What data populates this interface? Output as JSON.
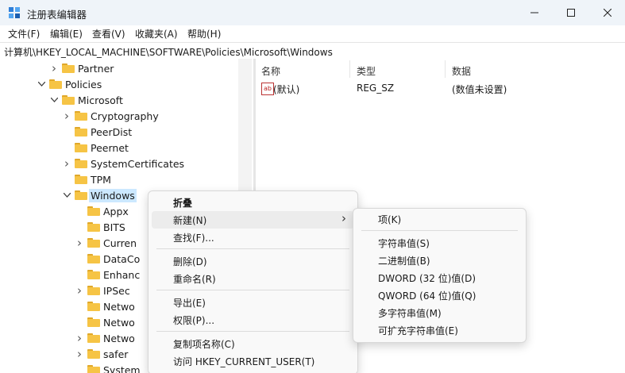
{
  "window": {
    "title": "注册表编辑器",
    "controls": {
      "minimize": "minimize",
      "maximize": "maximize",
      "close": "close"
    }
  },
  "menubar": [
    "文件(F)",
    "编辑(E)",
    "查看(V)",
    "收藏夹(A)",
    "帮助(H)"
  ],
  "address": "计算机\\HKEY_LOCAL_MACHINE\\SOFTWARE\\Policies\\Microsoft\\Windows",
  "tree": [
    {
      "label": "Partner",
      "expander": "right"
    },
    {
      "label": "Policies",
      "expander": "down"
    },
    {
      "label": "Microsoft",
      "expander": "down"
    },
    {
      "label": "Cryptography",
      "expander": "right"
    },
    {
      "label": "PeerDist",
      "expander": ""
    },
    {
      "label": "Peernet",
      "expander": ""
    },
    {
      "label": "SystemCertificates",
      "expander": "right"
    },
    {
      "label": "TPM",
      "expander": ""
    },
    {
      "label": "Windows",
      "expander": "down",
      "selected": true
    },
    {
      "label": "Appx",
      "expander": ""
    },
    {
      "label": "BITS",
      "expander": ""
    },
    {
      "label": "Curren",
      "expander": "right"
    },
    {
      "label": "DataCo",
      "expander": ""
    },
    {
      "label": "Enhanc",
      "expander": ""
    },
    {
      "label": "IPSec",
      "expander": "right"
    },
    {
      "label": "Netwo",
      "expander": ""
    },
    {
      "label": "Netwo",
      "expander": ""
    },
    {
      "label": "Netwo",
      "expander": "right"
    },
    {
      "label": "safer",
      "expander": "right"
    },
    {
      "label": "System",
      "expander": ""
    }
  ],
  "list": {
    "columns": [
      "名称",
      "类型",
      "数据"
    ],
    "rows": [
      {
        "name": "(默认)",
        "type": "REG_SZ",
        "data": "(数值未设置)"
      }
    ]
  },
  "context_menu": {
    "items": [
      {
        "label": "折叠",
        "bold": true
      },
      {
        "label": "新建(N)",
        "submenu": true,
        "highlighted": true
      },
      {
        "label": "查找(F)..."
      },
      {
        "sep": true
      },
      {
        "label": "删除(D)"
      },
      {
        "label": "重命名(R)"
      },
      {
        "sep": true
      },
      {
        "label": "导出(E)"
      },
      {
        "label": "权限(P)..."
      },
      {
        "sep": true
      },
      {
        "label": "复制项名称(C)"
      },
      {
        "label": "访问 HKEY_CURRENT_USER(T)"
      }
    ]
  },
  "submenu": {
    "items": [
      {
        "label": "项(K)"
      },
      {
        "sep": true
      },
      {
        "label": "字符串值(S)"
      },
      {
        "label": "二进制值(B)"
      },
      {
        "label": "DWORD (32 位)值(D)"
      },
      {
        "label": "QWORD (64 位)值(Q)"
      },
      {
        "label": "多字符串值(M)"
      },
      {
        "label": "可扩充字符串值(E)"
      }
    ]
  },
  "colors": {
    "folder": "#f6c445",
    "selection": "#cce8ff",
    "titlebar": "#eff4f9"
  }
}
